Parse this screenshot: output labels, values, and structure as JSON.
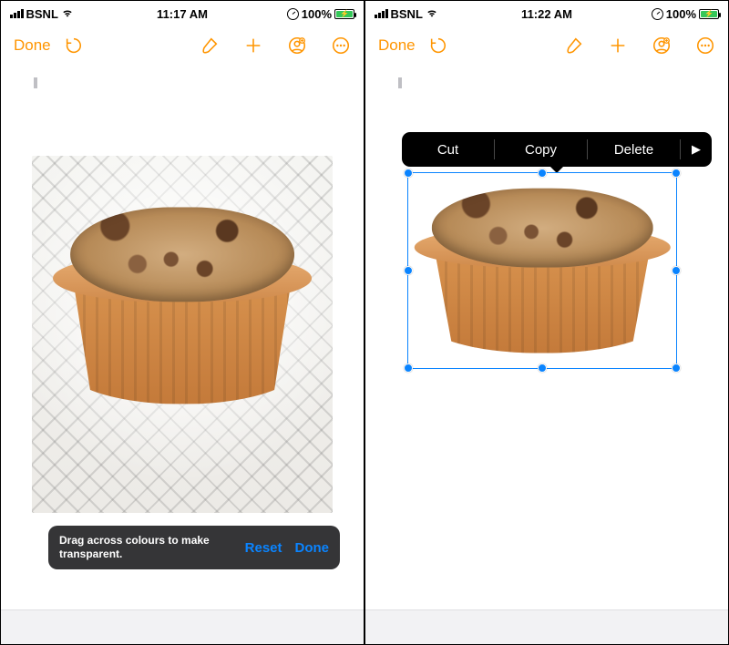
{
  "left": {
    "status": {
      "carrier": "BSNL",
      "time": "11:17 AM",
      "battery_pct": "100%"
    },
    "toolbar": {
      "done": "Done"
    },
    "alpha": {
      "message": "Drag across colours to make transparent.",
      "reset": "Reset",
      "done": "Done"
    }
  },
  "right": {
    "status": {
      "carrier": "BSNL",
      "time": "11:22 AM",
      "battery_pct": "100%"
    },
    "toolbar": {
      "done": "Done"
    },
    "context_menu": {
      "cut": "Cut",
      "copy": "Copy",
      "delete": "Delete"
    }
  },
  "icons": {
    "undo": "undo-icon",
    "brush": "brush-icon",
    "plus": "plus-icon",
    "share_person": "share-person-icon",
    "more": "more-icon",
    "wifi": "wifi-icon",
    "signal": "signal-icon",
    "battery": "battery-icon",
    "clock_badge": "clock-badge-icon",
    "menu_more": "menu-more-arrow-icon"
  }
}
